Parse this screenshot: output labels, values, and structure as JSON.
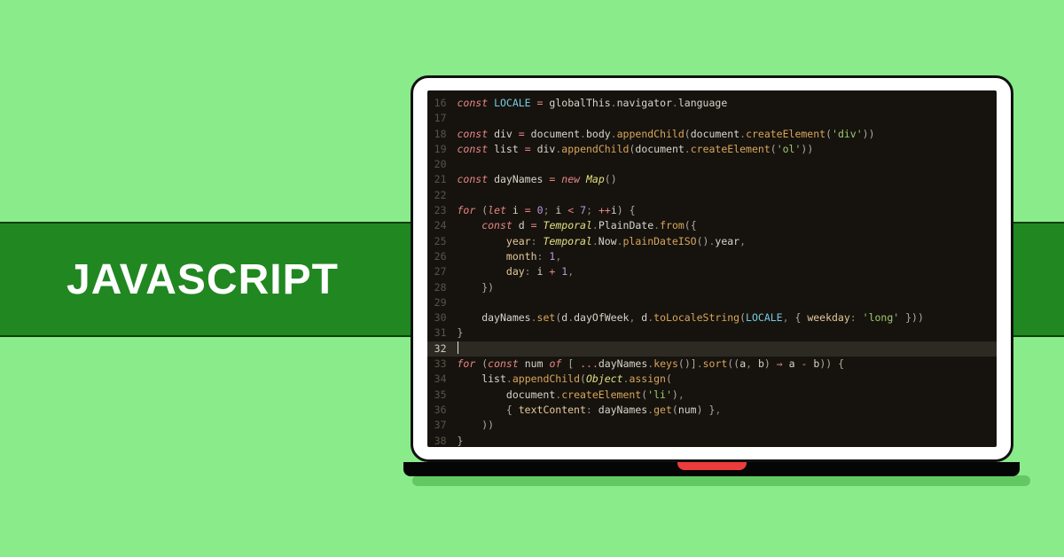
{
  "title": "JAVASCRIPT",
  "code_start_line": 16,
  "cursor_line": 32,
  "code_lines": [
    [
      [
        "kw",
        "const"
      ],
      [
        "sp",
        " "
      ],
      [
        "loc",
        "LOCALE"
      ],
      [
        "sp",
        " "
      ],
      [
        "op",
        "="
      ],
      [
        "sp",
        " "
      ],
      [
        "var",
        "globalThis"
      ],
      [
        "pn",
        "."
      ],
      [
        "var",
        "navigator"
      ],
      [
        "pn",
        "."
      ],
      [
        "var",
        "language"
      ]
    ],
    [],
    [
      [
        "kw",
        "const"
      ],
      [
        "sp",
        " "
      ],
      [
        "var",
        "div"
      ],
      [
        "sp",
        " "
      ],
      [
        "op",
        "="
      ],
      [
        "sp",
        " "
      ],
      [
        "var",
        "document"
      ],
      [
        "pn",
        "."
      ],
      [
        "var",
        "body"
      ],
      [
        "pn",
        "."
      ],
      [
        "fn",
        "appendChild"
      ],
      [
        "par",
        "("
      ],
      [
        "var",
        "document"
      ],
      [
        "pn",
        "."
      ],
      [
        "fn",
        "createElement"
      ],
      [
        "par",
        "("
      ],
      [
        "str",
        "'div'"
      ],
      [
        "par",
        "))"
      ]
    ],
    [
      [
        "kw",
        "const"
      ],
      [
        "sp",
        " "
      ],
      [
        "var",
        "list"
      ],
      [
        "sp",
        " "
      ],
      [
        "op",
        "="
      ],
      [
        "sp",
        " "
      ],
      [
        "var",
        "div"
      ],
      [
        "pn",
        "."
      ],
      [
        "fn",
        "appendChild"
      ],
      [
        "par",
        "("
      ],
      [
        "var",
        "document"
      ],
      [
        "pn",
        "."
      ],
      [
        "fn",
        "createElement"
      ],
      [
        "par",
        "("
      ],
      [
        "str",
        "'ol'"
      ],
      [
        "par",
        "))"
      ]
    ],
    [],
    [
      [
        "kw",
        "const"
      ],
      [
        "sp",
        " "
      ],
      [
        "var",
        "dayNames"
      ],
      [
        "sp",
        " "
      ],
      [
        "op",
        "="
      ],
      [
        "sp",
        " "
      ],
      [
        "kw",
        "new"
      ],
      [
        "sp",
        " "
      ],
      [
        "typ",
        "Map"
      ],
      [
        "par",
        "()"
      ]
    ],
    [],
    [
      [
        "kw",
        "for"
      ],
      [
        "sp",
        " "
      ],
      [
        "par",
        "("
      ],
      [
        "kw",
        "let"
      ],
      [
        "sp",
        " "
      ],
      [
        "var",
        "i"
      ],
      [
        "sp",
        " "
      ],
      [
        "op",
        "="
      ],
      [
        "sp",
        " "
      ],
      [
        "num",
        "0"
      ],
      [
        "pn",
        "; "
      ],
      [
        "var",
        "i"
      ],
      [
        "sp",
        " "
      ],
      [
        "op",
        "<"
      ],
      [
        "sp",
        " "
      ],
      [
        "num",
        "7"
      ],
      [
        "pn",
        "; "
      ],
      [
        "op",
        "++"
      ],
      [
        "var",
        "i"
      ],
      [
        "par",
        ") {"
      ]
    ],
    [
      [
        "sp",
        "    "
      ],
      [
        "kw",
        "const"
      ],
      [
        "sp",
        " "
      ],
      [
        "var",
        "d"
      ],
      [
        "sp",
        " "
      ],
      [
        "op",
        "="
      ],
      [
        "sp",
        " "
      ],
      [
        "typ",
        "Temporal"
      ],
      [
        "pn",
        "."
      ],
      [
        "var",
        "PlainDate"
      ],
      [
        "pn",
        "."
      ],
      [
        "fn",
        "from"
      ],
      [
        "par",
        "({"
      ]
    ],
    [
      [
        "sp",
        "        "
      ],
      [
        "prop",
        "year"
      ],
      [
        "pn",
        ": "
      ],
      [
        "typ",
        "Temporal"
      ],
      [
        "pn",
        "."
      ],
      [
        "var",
        "Now"
      ],
      [
        "pn",
        "."
      ],
      [
        "fn",
        "plainDateISO"
      ],
      [
        "par",
        "()"
      ],
      [
        "pn",
        "."
      ],
      [
        "var",
        "year"
      ],
      [
        "pn",
        ","
      ]
    ],
    [
      [
        "sp",
        "        "
      ],
      [
        "prop",
        "month"
      ],
      [
        "pn",
        ": "
      ],
      [
        "num",
        "1"
      ],
      [
        "pn",
        ","
      ]
    ],
    [
      [
        "sp",
        "        "
      ],
      [
        "prop",
        "day"
      ],
      [
        "pn",
        ": "
      ],
      [
        "var",
        "i"
      ],
      [
        "sp",
        " "
      ],
      [
        "op",
        "+"
      ],
      [
        "sp",
        " "
      ],
      [
        "num",
        "1"
      ],
      [
        "pn",
        ","
      ]
    ],
    [
      [
        "sp",
        "    "
      ],
      [
        "par",
        "})"
      ]
    ],
    [],
    [
      [
        "sp",
        "    "
      ],
      [
        "var",
        "dayNames"
      ],
      [
        "pn",
        "."
      ],
      [
        "fn",
        "set"
      ],
      [
        "par",
        "("
      ],
      [
        "var",
        "d"
      ],
      [
        "pn",
        "."
      ],
      [
        "var",
        "dayOfWeek"
      ],
      [
        "pn",
        ", "
      ],
      [
        "var",
        "d"
      ],
      [
        "pn",
        "."
      ],
      [
        "fn",
        "toLocaleString"
      ],
      [
        "par",
        "("
      ],
      [
        "loc",
        "LOCALE"
      ],
      [
        "pn",
        ", "
      ],
      [
        "par",
        "{ "
      ],
      [
        "prop",
        "weekday"
      ],
      [
        "pn",
        ": "
      ],
      [
        "str",
        "'long'"
      ],
      [
        "par",
        " }))"
      ]
    ],
    [
      [
        "par",
        "}"
      ]
    ],
    [
      [
        "caret",
        ""
      ]
    ],
    [
      [
        "kw",
        "for"
      ],
      [
        "sp",
        " "
      ],
      [
        "par",
        "("
      ],
      [
        "kw",
        "const"
      ],
      [
        "sp",
        " "
      ],
      [
        "var",
        "num"
      ],
      [
        "sp",
        " "
      ],
      [
        "kw",
        "of"
      ],
      [
        "sp",
        " "
      ],
      [
        "par",
        "[ "
      ],
      [
        "op",
        "..."
      ],
      [
        "var",
        "dayNames"
      ],
      [
        "pn",
        "."
      ],
      [
        "fn",
        "keys"
      ],
      [
        "par",
        "()]"
      ],
      [
        "pn",
        "."
      ],
      [
        "fn",
        "sort"
      ],
      [
        "par",
        "(("
      ],
      [
        "var",
        "a"
      ],
      [
        "pn",
        ", "
      ],
      [
        "var",
        "b"
      ],
      [
        "par",
        ") "
      ],
      [
        "op",
        "⇒"
      ],
      [
        "sp",
        " "
      ],
      [
        "var",
        "a"
      ],
      [
        "sp",
        " "
      ],
      [
        "op",
        "-"
      ],
      [
        "sp",
        " "
      ],
      [
        "var",
        "b"
      ],
      [
        "par",
        ")) {"
      ]
    ],
    [
      [
        "sp",
        "    "
      ],
      [
        "var",
        "list"
      ],
      [
        "pn",
        "."
      ],
      [
        "fn",
        "appendChild"
      ],
      [
        "par",
        "("
      ],
      [
        "typ",
        "Object"
      ],
      [
        "pn",
        "."
      ],
      [
        "fn",
        "assign"
      ],
      [
        "par",
        "("
      ]
    ],
    [
      [
        "sp",
        "        "
      ],
      [
        "var",
        "document"
      ],
      [
        "pn",
        "."
      ],
      [
        "fn",
        "createElement"
      ],
      [
        "par",
        "("
      ],
      [
        "str",
        "'li'"
      ],
      [
        "par",
        ")"
      ],
      [
        "pn",
        ","
      ]
    ],
    [
      [
        "sp",
        "        "
      ],
      [
        "par",
        "{ "
      ],
      [
        "prop",
        "textContent"
      ],
      [
        "pn",
        ": "
      ],
      [
        "var",
        "dayNames"
      ],
      [
        "pn",
        "."
      ],
      [
        "fn",
        "get"
      ],
      [
        "par",
        "("
      ],
      [
        "var",
        "num"
      ],
      [
        "par",
        ") }"
      ],
      [
        "pn",
        ","
      ]
    ],
    [
      [
        "sp",
        "    "
      ],
      [
        "par",
        "))"
      ]
    ],
    [
      [
        "par",
        "}"
      ]
    ]
  ]
}
